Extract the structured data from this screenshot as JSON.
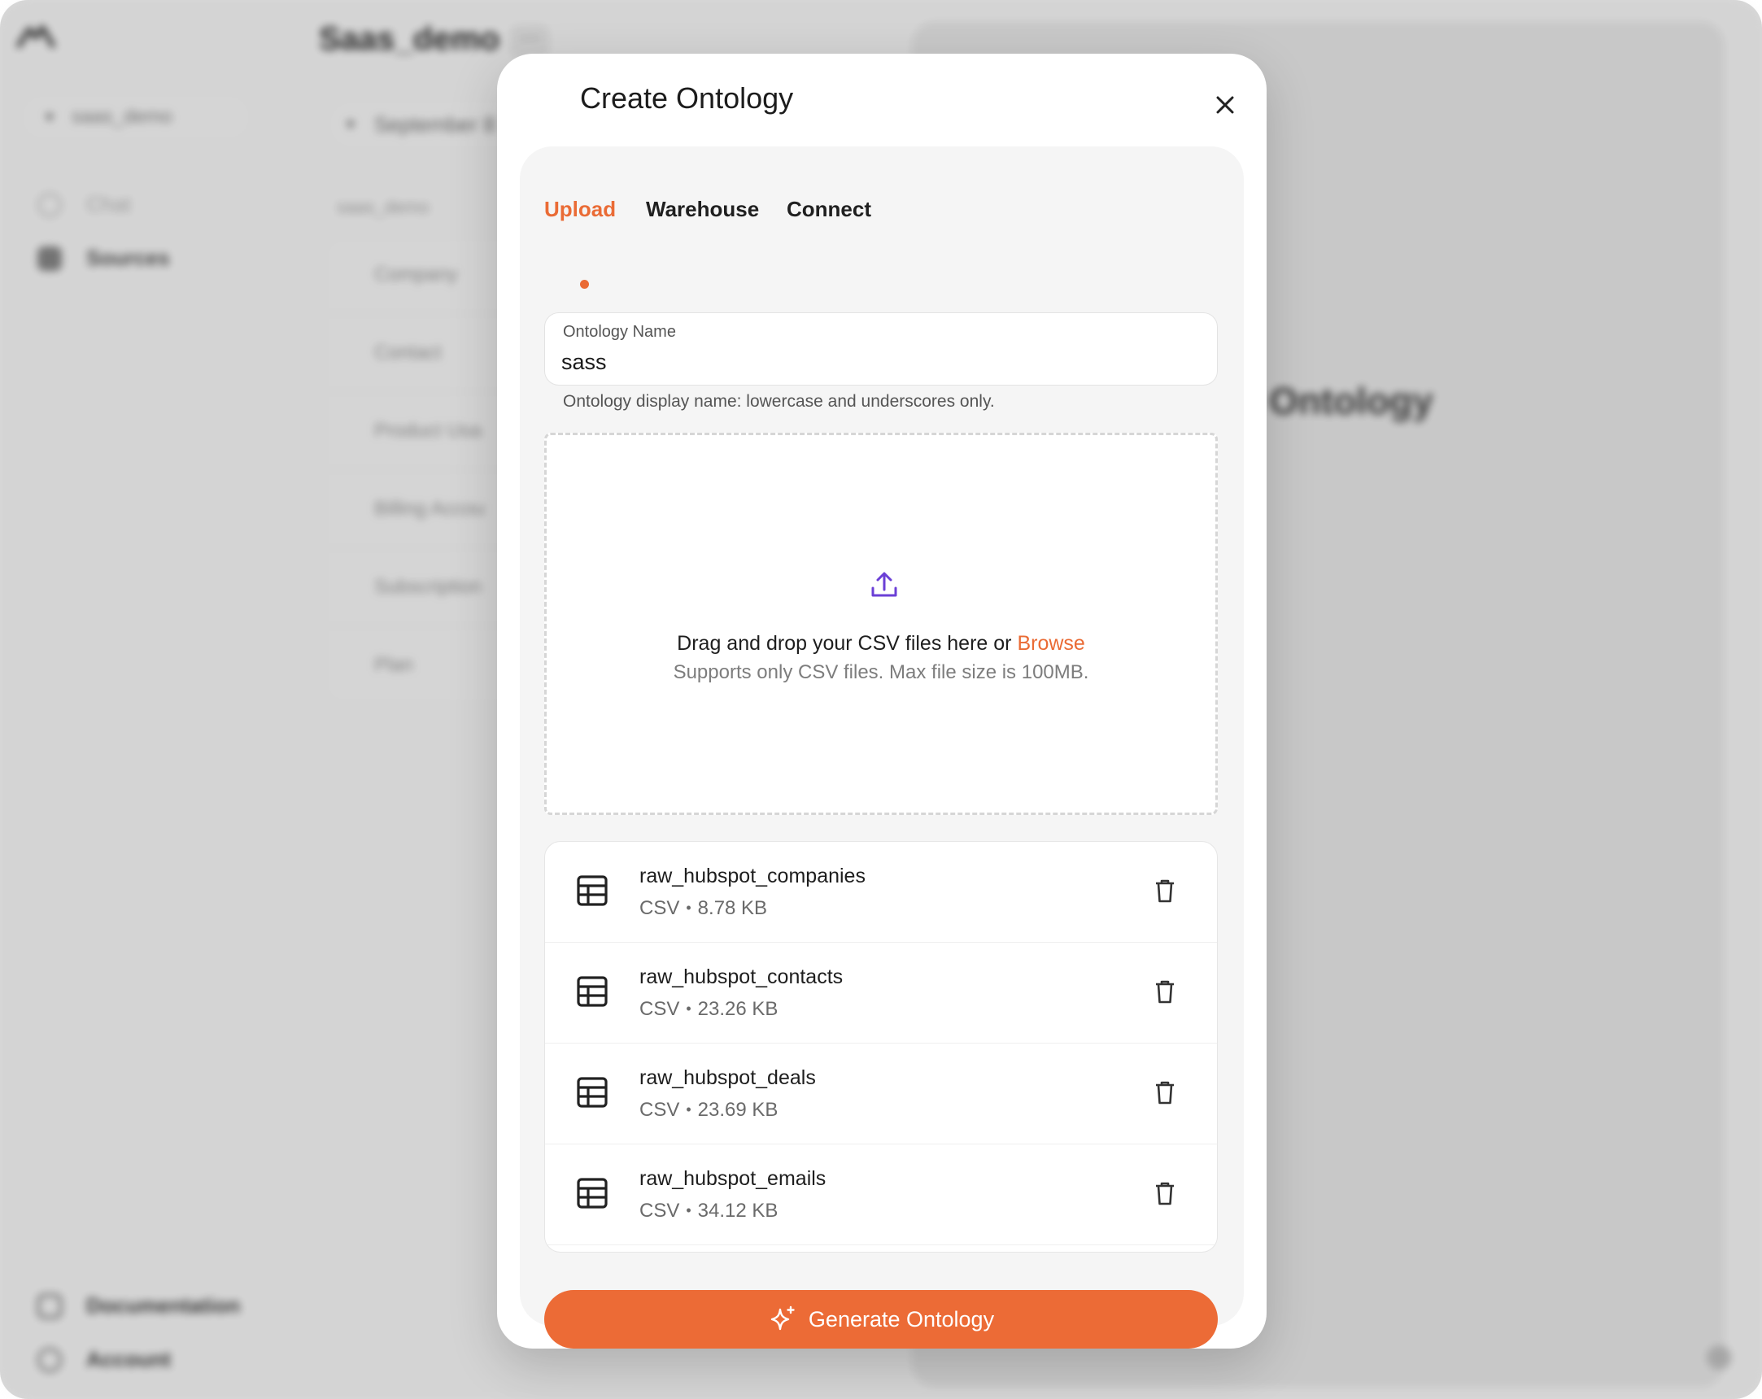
{
  "background": {
    "workspace_selector": "saas_demo",
    "nav": {
      "chat": "Chat",
      "sources": "Sources",
      "documentation": "Documentation",
      "account": "Account"
    },
    "page_title": "Saas_demo",
    "more_label": "···",
    "date_selector": "September 8",
    "section_label": "saas_demo",
    "tables": [
      "Company",
      "Contact",
      "Product Usa",
      "Billing Accou",
      "Subscription",
      "Plan"
    ],
    "right_panel_title": "Ontology"
  },
  "modal": {
    "title": "Create Ontology",
    "close_icon": "close-icon",
    "tabs": [
      {
        "label": "Upload",
        "active": true
      },
      {
        "label": "Warehouse",
        "active": false
      },
      {
        "label": "Connect",
        "active": false
      }
    ],
    "ontology_name": {
      "label": "Ontology Name",
      "value": "sass",
      "help": "Ontology display name: lowercase and underscores only."
    },
    "dropzone": {
      "icon": "upload-icon",
      "text": "Drag and drop your CSV files here or ",
      "browse": "Browse",
      "subtext": "Supports only CSV files. Max file size is 100MB."
    },
    "files": [
      {
        "name": "raw_hubspot_companies",
        "type": "CSV",
        "size": "8.78 KB"
      },
      {
        "name": "raw_hubspot_contacts",
        "type": "CSV",
        "size": "23.26 KB"
      },
      {
        "name": "raw_hubspot_deals",
        "type": "CSV",
        "size": "23.69 KB"
      },
      {
        "name": "raw_hubspot_emails",
        "type": "CSV",
        "size": "34.12 KB"
      }
    ],
    "meta_separator": "•",
    "generate_button": "Generate Ontology"
  },
  "colors": {
    "accent": "#ea6b35",
    "button": "#ec6b36",
    "icon_purple": "#6b3fd6"
  }
}
